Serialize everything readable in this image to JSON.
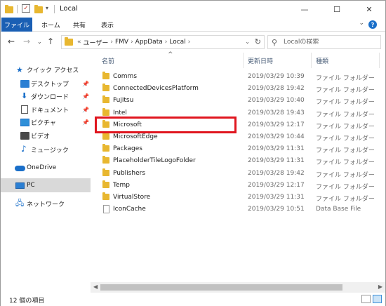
{
  "window": {
    "title": "Local",
    "controls": {
      "minimize": "—",
      "maximize": "☐",
      "close": "✕"
    }
  },
  "ribbon": {
    "file_tab": "ファイル",
    "tabs": [
      "ホーム",
      "共有",
      "表示"
    ]
  },
  "address": {
    "overflow": "«",
    "crumbs": [
      "ユーザー",
      "FMV",
      "AppData",
      "Local"
    ]
  },
  "search": {
    "placeholder": "Localの検索"
  },
  "nav_pane": {
    "quick_access": "クイック アクセス",
    "items": [
      {
        "label": "デスクトップ",
        "icon": "desktop-icon",
        "pinned": true
      },
      {
        "label": "ダウンロード",
        "icon": "download-icon",
        "pinned": true
      },
      {
        "label": "ドキュメント",
        "icon": "document-icon",
        "pinned": true
      },
      {
        "label": "ピクチャ",
        "icon": "picture-icon",
        "pinned": true
      },
      {
        "label": "ビデオ",
        "icon": "video-icon",
        "pinned": false
      },
      {
        "label": "ミュージック",
        "icon": "music-icon",
        "pinned": false
      }
    ],
    "onedrive": "OneDrive",
    "pc": "PC",
    "network": "ネットワーク"
  },
  "columns": {
    "name": "名前",
    "modified": "更新日時",
    "type": "種類"
  },
  "files": [
    {
      "name": "Comms",
      "modified": "2019/03/29 10:39",
      "type": "ファイル フォルダー",
      "kind": "folder"
    },
    {
      "name": "ConnectedDevicesPlatform",
      "modified": "2019/03/28 19:42",
      "type": "ファイル フォルダー",
      "kind": "folder"
    },
    {
      "name": "Fujitsu",
      "modified": "2019/03/29 10:40",
      "type": "ファイル フォルダー",
      "kind": "folder"
    },
    {
      "name": "Intel",
      "modified": "2019/03/28 19:43",
      "type": "ファイル フォルダー",
      "kind": "folder"
    },
    {
      "name": "Microsoft",
      "modified": "2019/03/29 12:17",
      "type": "ファイル フォルダー",
      "kind": "folder"
    },
    {
      "name": "MicrosoftEdge",
      "modified": "2019/03/29 10:44",
      "type": "ファイル フォルダー",
      "kind": "folder"
    },
    {
      "name": "Packages",
      "modified": "2019/03/29 11:31",
      "type": "ファイル フォルダー",
      "kind": "folder"
    },
    {
      "name": "PlaceholderTileLogoFolder",
      "modified": "2019/03/29 11:31",
      "type": "ファイル フォルダー",
      "kind": "folder"
    },
    {
      "name": "Publishers",
      "modified": "2019/03/28 19:42",
      "type": "ファイル フォルダー",
      "kind": "folder"
    },
    {
      "name": "Temp",
      "modified": "2019/03/29 12:17",
      "type": "ファイル フォルダー",
      "kind": "folder"
    },
    {
      "name": "VirtualStore",
      "modified": "2019/03/29 11:31",
      "type": "ファイル フォルダー",
      "kind": "folder"
    },
    {
      "name": "IconCache",
      "modified": "2019/03/29 10:51",
      "type": "Data Base File",
      "kind": "file"
    }
  ],
  "highlighted_item": "Microsoft",
  "status": {
    "item_count": "12 個の項目"
  },
  "colors": {
    "file_tab": "#1a5fb4",
    "highlight_border": "#e0161f",
    "folder": "#e8b730"
  }
}
